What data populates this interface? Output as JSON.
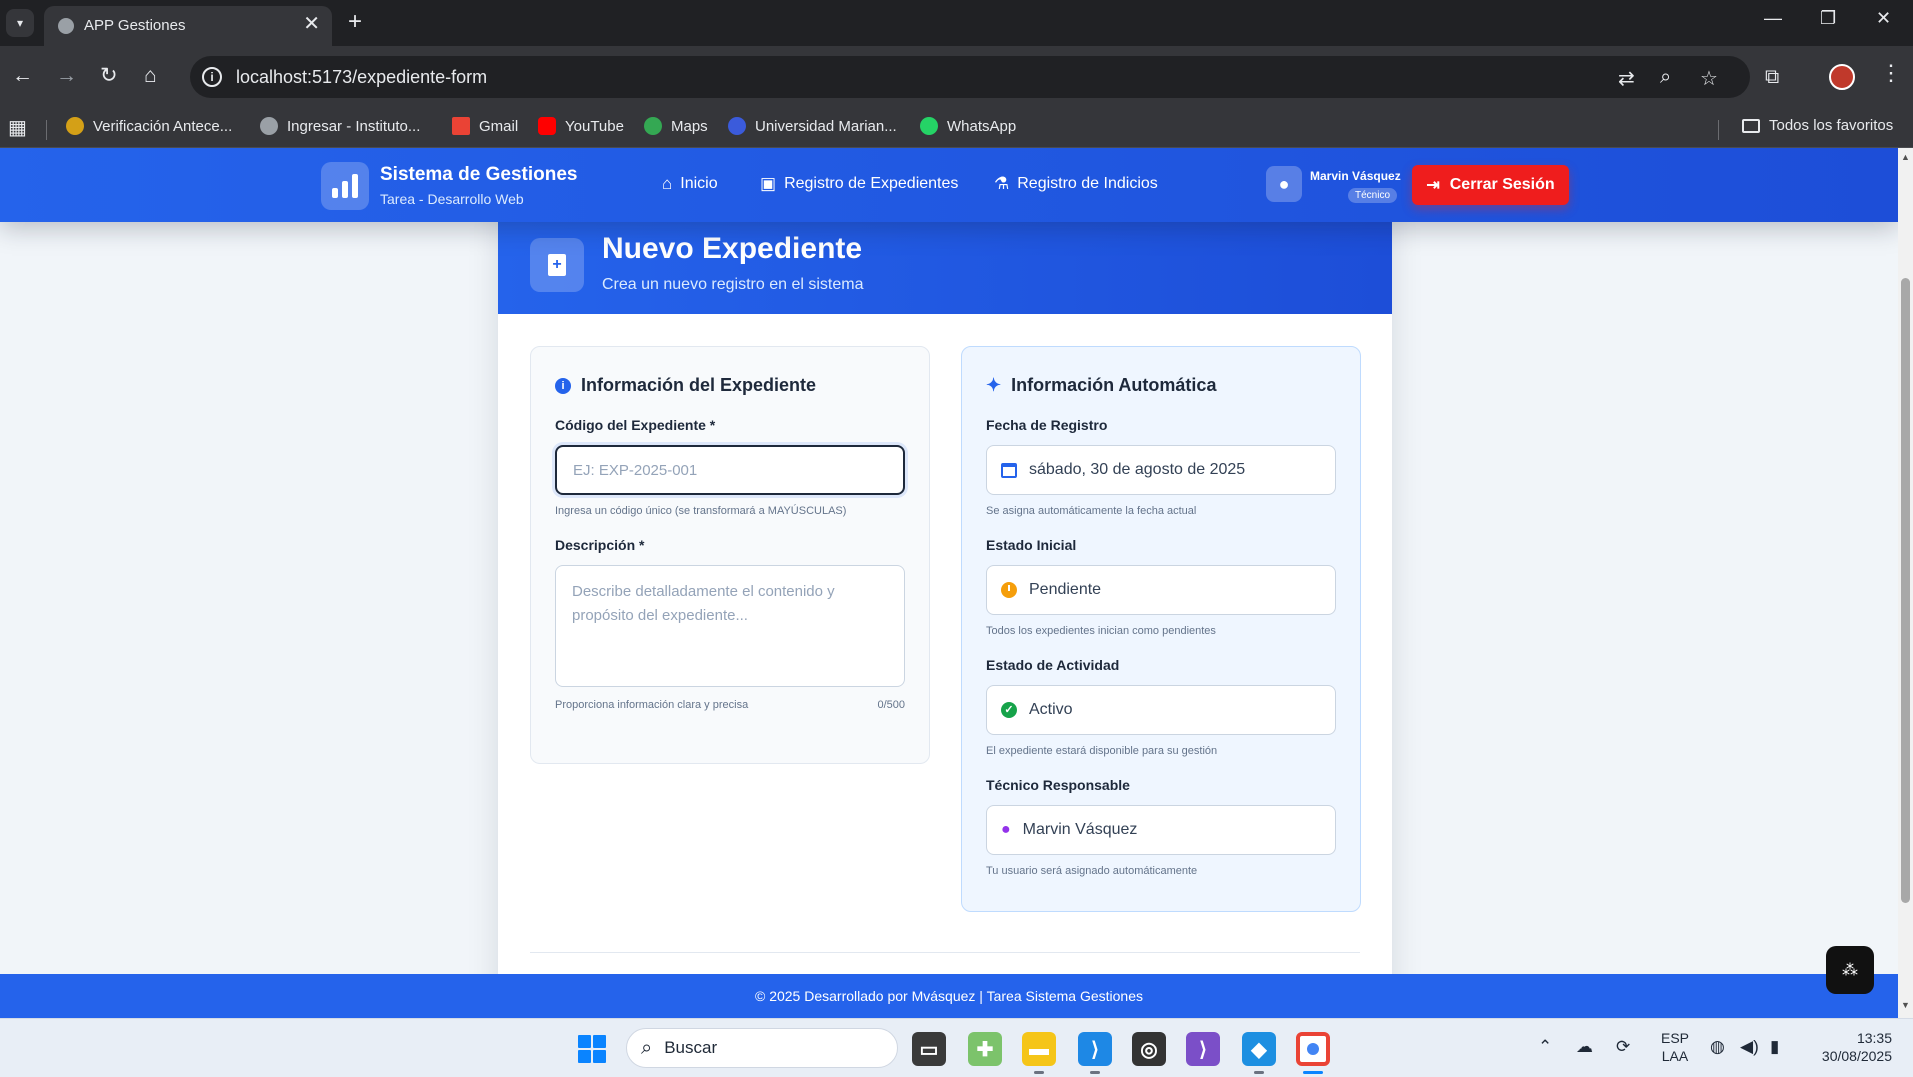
{
  "browser": {
    "tab_title": "APP Gestiones",
    "url": "localhost:5173/expediente-form",
    "bookmarks": [
      {
        "label": "Verificación Antece...",
        "color": "#d4a017"
      },
      {
        "label": "Ingresar - Instituto...",
        "color": "#9aa0a6"
      },
      {
        "label": "Gmail",
        "color": "#ea4335"
      },
      {
        "label": "YouTube",
        "color": "#ff0000"
      },
      {
        "label": "Maps",
        "color": "#34a853"
      },
      {
        "label": "Universidad Marian...",
        "color": "#3b5bdb"
      },
      {
        "label": "WhatsApp",
        "color": "#25d366"
      }
    ],
    "all_favorites": "Todos los favoritos"
  },
  "header": {
    "brand_title": "Sistema de Gestiones",
    "brand_subtitle": "Tarea - Desarrollo Web",
    "nav": [
      {
        "label": "Inicio",
        "icon": "home-icon"
      },
      {
        "label": "Registro de Expedientes",
        "icon": "folder-plus-icon"
      },
      {
        "label": "Registro de Indicios",
        "icon": "flask-icon"
      }
    ],
    "user_name": "Marvin Vásquez",
    "user_role": "Técnico",
    "logout_label": "Cerrar Sesión"
  },
  "page": {
    "title": "Nuevo Expediente",
    "subtitle": "Crea un nuevo registro en el sistema"
  },
  "form": {
    "section_title": "Información del Expediente",
    "code_label": "Código del Expediente *",
    "code_placeholder": "EJ: EXP-2025-001",
    "code_value": "",
    "code_help": "Ingresa un código único (se transformará a MAYÚSCULAS)",
    "desc_label": "Descripción *",
    "desc_placeholder": "Describe detalladamente el contenido y propósito del expediente...",
    "desc_help": "Proporciona información clara y precisa",
    "desc_counter": "0/500"
  },
  "auto": {
    "section_title": "Información Automática",
    "fields": [
      {
        "label": "Fecha de Registro",
        "value": "sábado, 30 de agosto de 2025",
        "help": "Se asigna automáticamente la fecha actual",
        "icon": "calendar-icon"
      },
      {
        "label": "Estado Inicial",
        "value": "Pendiente",
        "help": "Todos los expedientes inician como pendientes",
        "icon": "clock-icon"
      },
      {
        "label": "Estado de Actividad",
        "value": "Activo",
        "help": "El expediente estará disponible para su gestión",
        "icon": "check-circle-icon"
      },
      {
        "label": "Técnico Responsable",
        "value": "Marvin Vásquez",
        "help": "Tu usuario será asignado automáticamente",
        "icon": "user-icon"
      }
    ]
  },
  "footer": {
    "text": "© 2025 Desarrollado por Mvásquez | Tarea Sistema Gestiones"
  },
  "taskbar": {
    "search_label": "Buscar",
    "lang_top": "ESP",
    "lang_bottom": "LAA",
    "time": "13:35",
    "date": "30/08/2025"
  },
  "colors": {
    "primary": "#2563eb",
    "danger": "#ef1d1d",
    "pending": "#f59e0b",
    "active": "#16a34a",
    "user": "#9333ea"
  }
}
